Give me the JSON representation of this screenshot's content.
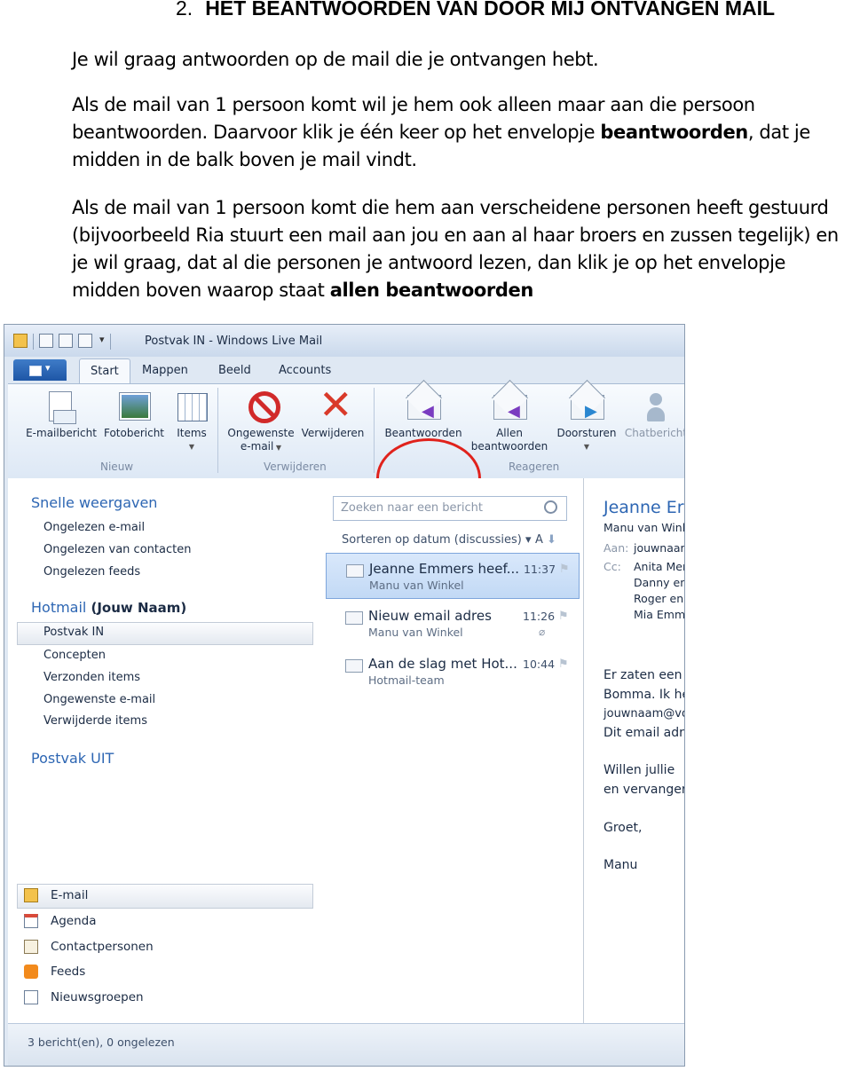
{
  "heading": {
    "number": "2.",
    "title": "HET BEANTWOORDEN VAN DOOR MIJ ONTVANGEN MAIL"
  },
  "paragraphs": {
    "p1": "Je wil graag antwoorden op de mail die je ontvangen hebt.",
    "p2_a": "Als de mail van 1 persoon komt wil je hem ook alleen maar aan die persoon beantwoorden. Daarvoor klik je één keer op het envelopje ",
    "p2_b": "beantwoorden",
    "p2_c": ", dat je midden in de balk boven je mail vindt.",
    "p3_a": "Als de mail van 1 persoon komt die hem aan verscheidene personen heeft gestuurd (bijvoorbeeld Ria stuurt een mail aan jou en aan al haar broers en zussen tegelijk) en je wil graag, dat al die personen je antwoord lezen, dan klik je op het envelopje midden boven waarop staat ",
    "p3_b": "allen beantwoorden"
  },
  "window": {
    "title": "Postvak IN - Windows Live Mail"
  },
  "tabs": [
    "Start",
    "Mappen",
    "Beeld",
    "Accounts"
  ],
  "ribbon": {
    "buttons": {
      "email": "E-mailbericht",
      "photo": "Fotobericht",
      "items": "Items",
      "junk_1": "Ongewenste",
      "junk_2": "e-mail",
      "delete": "Verwijderen",
      "reply": "Beantwoorden",
      "reply_all_1": "Allen",
      "reply_all_2": "beantwoorden",
      "forward": "Doorsturen",
      "chat": "Chatbericht"
    },
    "groups": {
      "new": "Nieuw",
      "delete": "Verwijderen",
      "respond": "Reageren"
    }
  },
  "nav": {
    "quick_views": "Snelle weergaven",
    "quick_items": [
      "Ongelezen e-mail",
      "Ongelezen van contacten",
      "Ongelezen feeds"
    ],
    "hotmail": "Hotmail",
    "account": "(Jouw Naam)",
    "folders": [
      "Postvak IN",
      "Concepten",
      "Verzonden items",
      "Ongewenste e-mail",
      "Verwijderde items"
    ],
    "outbox": "Postvak UIT",
    "modules": [
      "E-mail",
      "Agenda",
      "Contactpersonen",
      "Feeds",
      "Nieuwsgroepen"
    ]
  },
  "list": {
    "search_placeholder": "Zoeken naar een bericht",
    "sort": "Sorteren op datum (discussies)",
    "sort_dir": "A",
    "messages": [
      {
        "subject": "Jeanne Emmers heef...",
        "from": "Manu van Winkel",
        "time": "11:37"
      },
      {
        "subject": "Nieuw email adres",
        "from": "Manu van Winkel",
        "time": "11:26"
      },
      {
        "subject": "Aan de slag met Hot...",
        "from": "Hotmail-team",
        "time": "10:44"
      }
    ]
  },
  "reading": {
    "title": "Jeanne Er",
    "from": "Manu van Winl",
    "to_label": "Aan:",
    "to": "jouwnaar",
    "cc_label": "Cc:",
    "cc": [
      "Anita Mer",
      "Danny en",
      "Roger en",
      "Mia Emm"
    ],
    "body": [
      "Er zaten een",
      "Bomma. Ik he",
      "jouwnaam@vo",
      "Dit email adre",
      "Willen jullie",
      "en vervanger",
      "Groet,",
      "Manu"
    ]
  },
  "status": "3 bericht(en), 0 ongelezen",
  "colors": {
    "annotation_circle": "#e0221c",
    "link_blue": "#2d66b3"
  }
}
